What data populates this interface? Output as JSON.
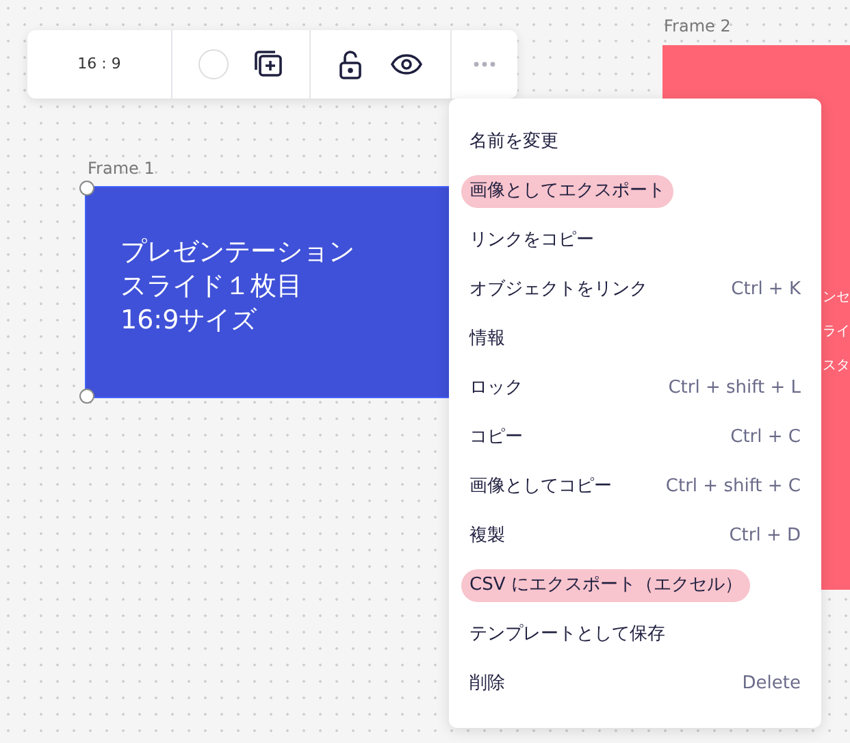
{
  "toolbar": {
    "aspect_ratio": "16 : 9"
  },
  "frames": [
    {
      "label": "Frame 1",
      "color": "#3f51d8",
      "selected": true,
      "lines": [
        "プレゼンテーション",
        "スライド１枚目",
        "16:9サイズ"
      ]
    },
    {
      "label": "Frame 2",
      "color": "#fe6474",
      "selected": false,
      "lines": [
        "ンセ",
        "ライ",
        "スタ"
      ]
    }
  ],
  "context_menu": [
    {
      "label": "名前を変更",
      "highlighted": false
    },
    {
      "label": "画像としてエクスポート",
      "highlighted": true
    },
    {
      "label": "リンクをコピー",
      "highlighted": false
    },
    {
      "label": "オブジェクトをリンク",
      "shortcut": "Ctrl + K",
      "highlighted": false
    },
    {
      "label": "情報",
      "highlighted": false
    },
    {
      "label": "ロック",
      "shortcut": "Ctrl + shift + L",
      "highlighted": false
    },
    {
      "label": "コピー",
      "shortcut": "Ctrl + C",
      "highlighted": false
    },
    {
      "label": "画像としてコピー",
      "shortcut": "Ctrl + shift + C",
      "highlighted": false
    },
    {
      "label": "複製",
      "shortcut": "Ctrl + D",
      "highlighted": false
    },
    {
      "label": "CSV にエクスポート（エクセル）",
      "highlighted": true
    },
    {
      "label": "テンプレートとして保存",
      "highlighted": false
    },
    {
      "label": "削除",
      "shortcut": "Delete",
      "highlighted": false
    }
  ]
}
